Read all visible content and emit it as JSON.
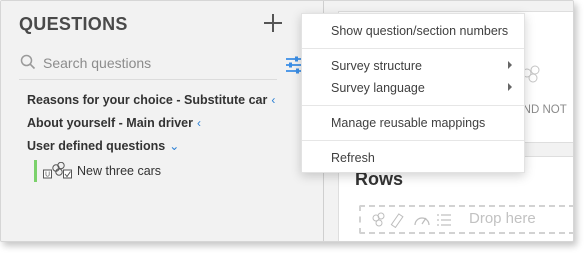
{
  "questions_panel": {
    "title": "QUESTIONS",
    "search": {
      "placeholder": "Search questions",
      "value": ""
    },
    "tree": [
      {
        "label": "Reasons for your choice - Substitute car",
        "chevron": "‹"
      },
      {
        "label": "About yourself - Main driver",
        "chevron": "‹"
      },
      {
        "label": "User defined questions",
        "chevron": "⌄"
      }
    ],
    "child_item": {
      "label": "New three cars",
      "accent_color": "#7bd16b"
    }
  },
  "menu": {
    "items": [
      {
        "label": "Show question/section numbers",
        "has_submenu": false
      },
      {
        "label": "Survey structure",
        "has_submenu": true
      },
      {
        "label": "Survey language",
        "has_submenu": true
      },
      {
        "label": "Manage reusable mappings",
        "has_submenu": false
      },
      {
        "label": "Refresh",
        "has_submenu": false
      }
    ]
  },
  "canvas": {
    "partial_text": "AND NOT",
    "rows_title": "Rows",
    "drop_here": "Drop here"
  },
  "colors": {
    "panel_bg": "#f2f2f2",
    "accent_blue": "#2a7fd4",
    "filter_icon_blue": "#3a8ee6",
    "child_accent_green": "#7bd16b"
  },
  "icons": [
    "plus-icon",
    "search-icon",
    "filter-icon",
    "question-type-icon",
    "drop-type-icons"
  ]
}
